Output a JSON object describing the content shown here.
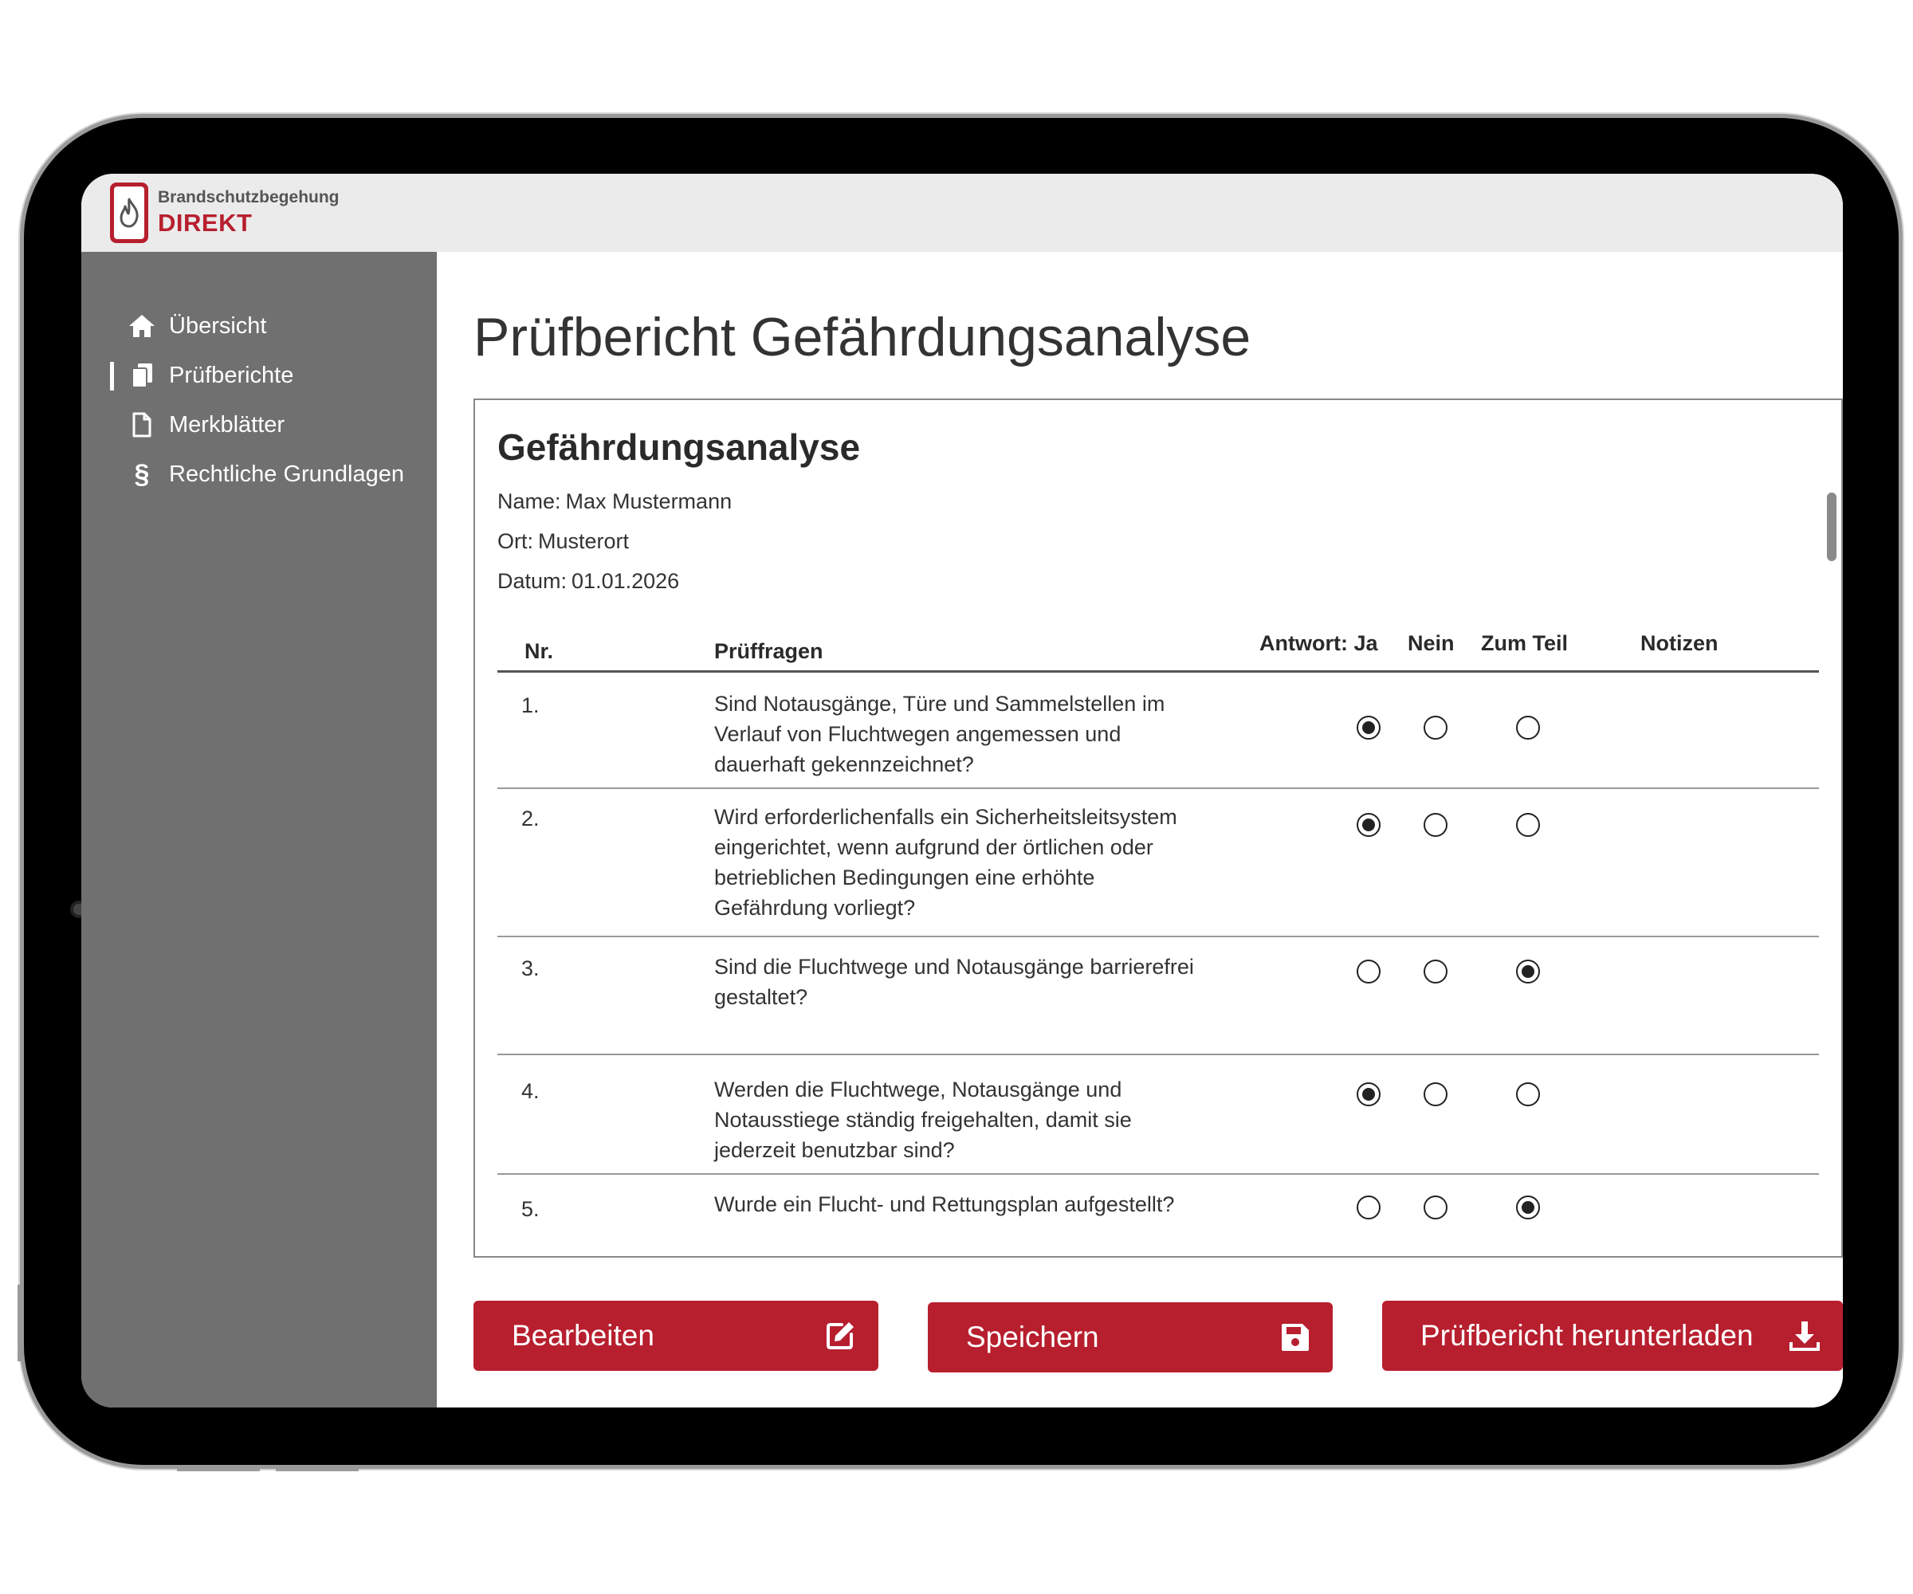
{
  "app": {
    "logo_small": "Brandschutzbegehung",
    "logo_big": "DIREKT",
    "brand_color": "#b71f2e"
  },
  "sidebar": {
    "items": [
      {
        "label": "Übersicht",
        "icon": "home-icon"
      },
      {
        "label": "Prüfberichte",
        "icon": "documents-icon"
      },
      {
        "label": "Merkblätter",
        "icon": "document-icon"
      },
      {
        "label": "Rechtliche Grundlagen",
        "icon": "paragraph-icon"
      }
    ],
    "active": "Prüfberichte"
  },
  "page": {
    "title": "Prüfbericht Gefährdungsanalyse"
  },
  "report": {
    "heading": "Gefährdungsanalyse",
    "name_label": "Name:",
    "name_value": "Max Mustermann",
    "ort_label": "Ort:",
    "ort_value": "Musterort",
    "datum_label": "Datum:",
    "datum_value": "01.01.2026",
    "columns": {
      "nr": "Nr.",
      "fragen": "Prüffragen",
      "ja": "Antwort: Ja",
      "nein": "Nein",
      "teil": "Zum Teil",
      "notizen": "Notizen"
    },
    "rows": [
      {
        "nr": "1.",
        "question": "Sind Notausgänge, Türe und Sammelstellen im Verlauf von Fluchtwegen angemessen und dauerhaft gekennzeichnet?",
        "answer": "ja"
      },
      {
        "nr": "2.",
        "question": "Wird erforderlichenfalls ein Sicherheitsleitsystem eingerichtet, wenn aufgrund der örtlichen oder betrieblichen Bedingungen eine erhöhte Gefährdung vorliegt?",
        "answer": "ja"
      },
      {
        "nr": "3.",
        "question": "Sind die Fluchtwege und Notausgänge barrierefrei gestaltet?",
        "answer": "teil"
      },
      {
        "nr": "4.",
        "question": "Werden die Fluchtwege, Notausgänge und Notausstiege ständig freigehalten, damit sie jederzeit benutzbar sind?",
        "answer": "ja"
      },
      {
        "nr": "5.",
        "question": "Wurde ein Flucht- und Rettungsplan aufgestellt?",
        "answer": "teil"
      }
    ]
  },
  "buttons": {
    "edit": "Bearbeiten",
    "save": "Speichern",
    "download": "Prüfbericht herunterladen"
  }
}
